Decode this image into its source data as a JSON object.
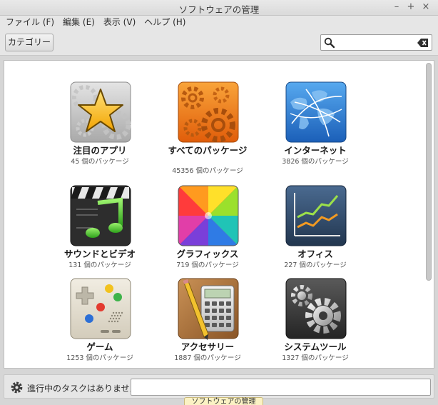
{
  "window": {
    "title": "ソフトウェアの管理",
    "minimize": "–",
    "maximize": "+",
    "close": "×"
  },
  "menu": [
    {
      "label": "ファイル (F)"
    },
    {
      "label": "編集 (E)"
    },
    {
      "label": "表示 (V)"
    },
    {
      "label": "ヘルプ (H)"
    }
  ],
  "toolbar": {
    "categories_label": "カテゴリー",
    "search": {
      "value": "",
      "placeholder": ""
    }
  },
  "categories": [
    {
      "name": "注目のアプリ",
      "count": "45 個のパッケージ",
      "icon": "featured-star-icon",
      "color": "#f4b400"
    },
    {
      "name": "すべてのパッケージ",
      "count": "45356 個のパッケージ",
      "icon": "all-packages-gears-icon",
      "color": "#ee7b12"
    },
    {
      "name": "インターネット",
      "count": "3826 個のパッケージ",
      "icon": "internet-globe-icon",
      "color": "#2d82d8"
    },
    {
      "name": "サウンドとビデオ",
      "count": "131 個のパッケージ",
      "icon": "sound-video-clapper-icon",
      "color": "#4cc330"
    },
    {
      "name": "グラフィックス",
      "count": "719 個のパッケージ",
      "icon": "graphics-colorwheel-icon",
      "color": "#e8328d"
    },
    {
      "name": "オフィス",
      "count": "227 個のパッケージ",
      "icon": "office-chart-icon",
      "color": "#2f4a6b"
    },
    {
      "name": "ゲーム",
      "count": "1253 個のパッケージ",
      "icon": "games-gamepad-icon",
      "color": "#e7e2d3"
    },
    {
      "name": "アクセサリー",
      "count": "1887 個のパッケージ",
      "icon": "accessories-calculator-icon",
      "color": "#a9733a"
    },
    {
      "name": "システムツール",
      "count": "1327 個のパッケージ",
      "icon": "system-tools-gear-icon",
      "color": "#3a3a3a"
    }
  ],
  "status": {
    "text": "進行中のタスクはありません",
    "tooltip": "ソフトウェアの管理"
  }
}
